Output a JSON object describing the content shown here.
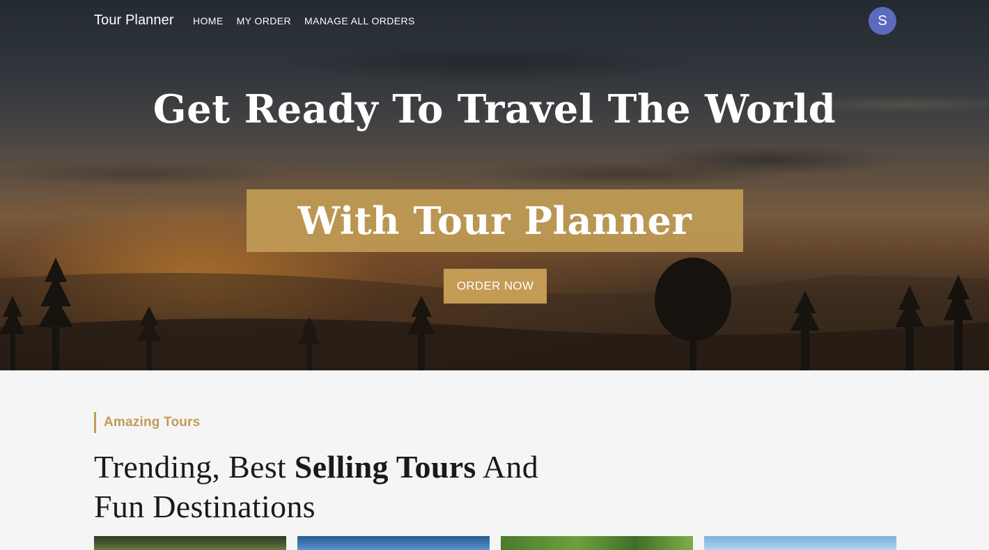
{
  "nav": {
    "brand": "Tour Planner",
    "links": [
      "HOME",
      "MY ORDER",
      "MANAGE ALL ORDERS"
    ],
    "avatar_initial": "S"
  },
  "hero": {
    "title": "Get Ready To Travel The World",
    "banner": "With Tour Planner",
    "cta": "ORDER NOW"
  },
  "section": {
    "eyebrow": "Amazing Tours",
    "title_part1": "Trending, Best ",
    "title_bold": "Selling Tours",
    "title_part2": " And Fun Destinations"
  },
  "colors": {
    "accent": "#c29b55",
    "avatar": "#5c6bc0",
    "section_bg": "#f5f5f5"
  }
}
